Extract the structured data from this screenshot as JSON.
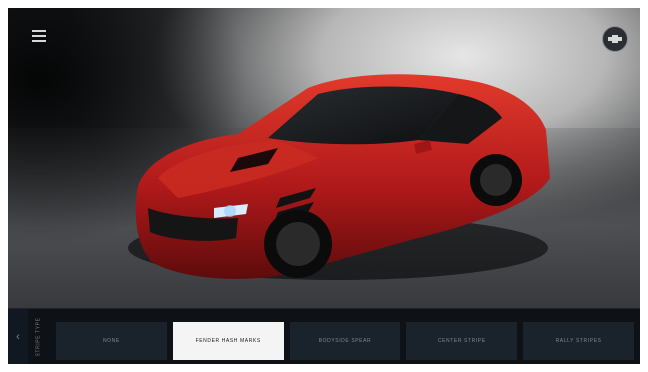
{
  "customizer": {
    "section_label": "STRIPE TYPE",
    "options": [
      {
        "label": "NONE",
        "selected": false
      },
      {
        "label": "FENDER HASH MARKS",
        "selected": true
      },
      {
        "label": "BODYSIDE SPEAR",
        "selected": false
      },
      {
        "label": "CENTER STRIPE",
        "selected": false
      },
      {
        "label": "RALLY STRIPES",
        "selected": false
      }
    ]
  },
  "icons": {
    "menu": "hamburger-menu-icon",
    "brand": "chevrolet-logo-icon",
    "back": "chevron-left-icon"
  },
  "colors": {
    "car_paint": "#b0191a",
    "selected_option": "#f4f4f4",
    "option_bg": "#1a222c",
    "bar_bg": "#0e1217"
  }
}
